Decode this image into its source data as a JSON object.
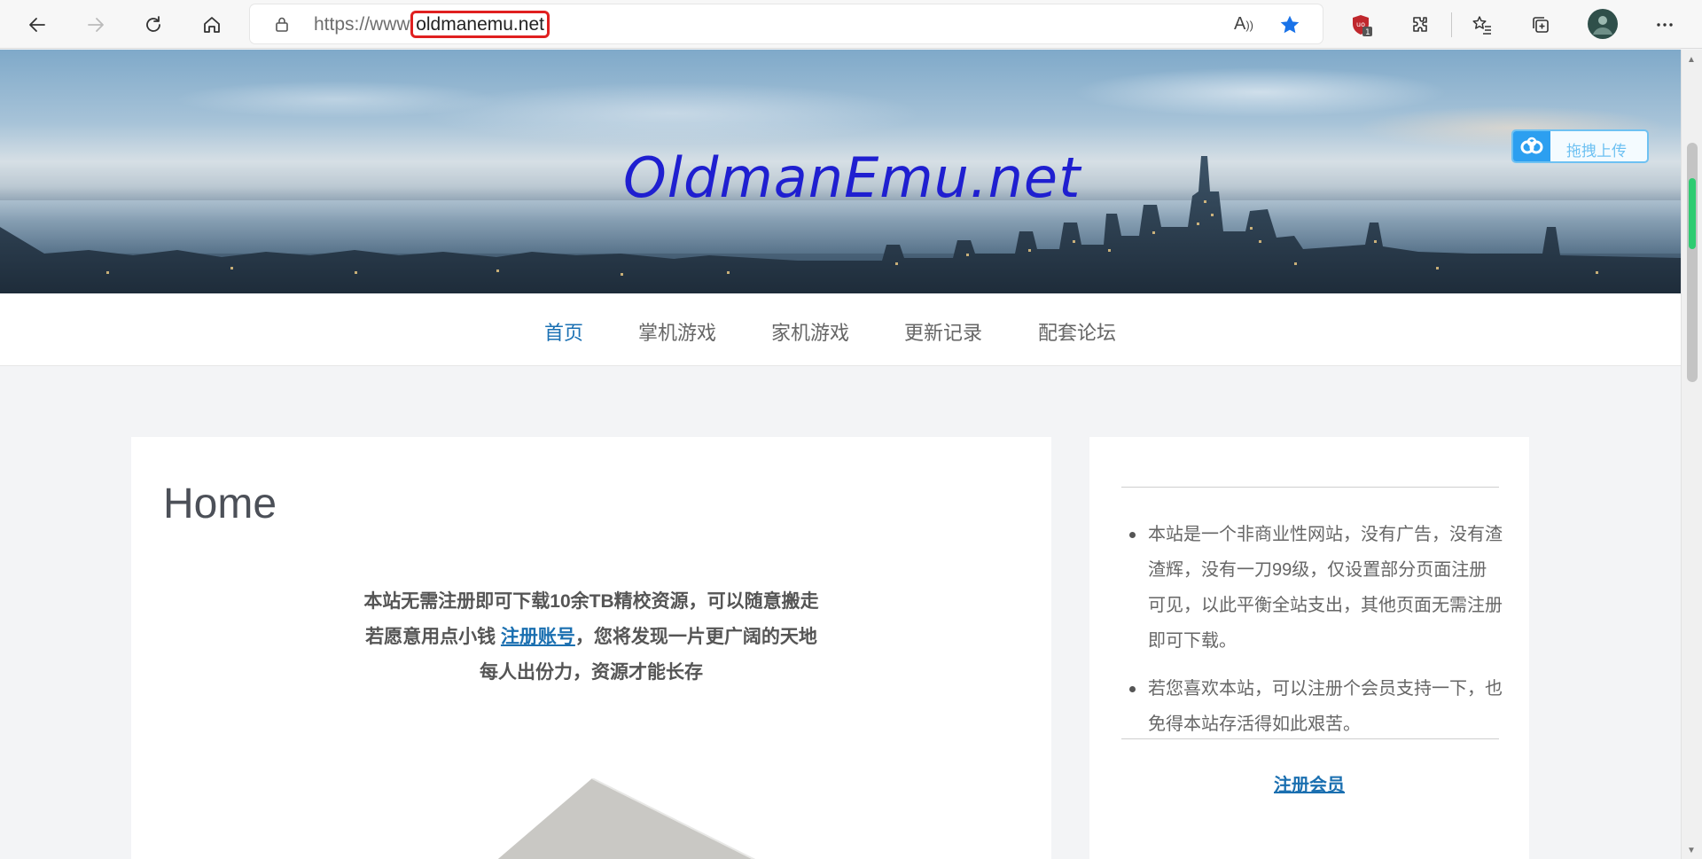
{
  "browser": {
    "url_prefix": "https://www.",
    "url_domain": "oldmanemu.net",
    "read_aloud_icon": "read-aloud-icon",
    "extension_badge": "1",
    "icons": [
      "back-icon",
      "forward-icon",
      "refresh-icon",
      "home-icon",
      "lock-icon",
      "read-aloud-icon",
      "favorite-star-icon",
      "ublock-icon",
      "extensions-icon",
      "favorites-icon",
      "collections-icon",
      "profile-avatar",
      "more-icon"
    ],
    "colors": {
      "star": "#1a73e8",
      "highlight_box": "#e02020",
      "ublock": "#c0272d"
    }
  },
  "banner": {
    "title": "OldmanEmu.net",
    "upload_label": "拖拽上传",
    "colors": {
      "title": "#1f1fd0",
      "upload": "#2c9ff0"
    }
  },
  "nav": {
    "items": [
      {
        "label": "首页",
        "active": true
      },
      {
        "label": "掌机游戏",
        "active": false
      },
      {
        "label": "家机游戏",
        "active": false
      },
      {
        "label": "更新记录",
        "active": false
      },
      {
        "label": "配套论坛",
        "active": false
      }
    ],
    "colors": {
      "active": "#1a70b3",
      "normal": "#666666"
    }
  },
  "main": {
    "title": "Home",
    "intro_line1": "本站无需注册即可下载10余TB精校资源，可以随意搬走",
    "intro_line2_pre": "若愿意用点小钱 ",
    "intro_link": "注册账号",
    "intro_line2_post": "，您将发现一片更广阔的天地",
    "intro_line3": "每人出份力，资源才能长存"
  },
  "sidebar": {
    "items": [
      "本站是一个非商业性网站，没有广告，没有渣渣辉，没有一刀99级，仅设置部分页面注册可见，以此平衡全站支出，其他页面无需注册即可下载。",
      "若您喜欢本站，可以注册个会员支持一下，也免得本站存活得如此艰苦。"
    ],
    "register_link": "注册会员"
  }
}
